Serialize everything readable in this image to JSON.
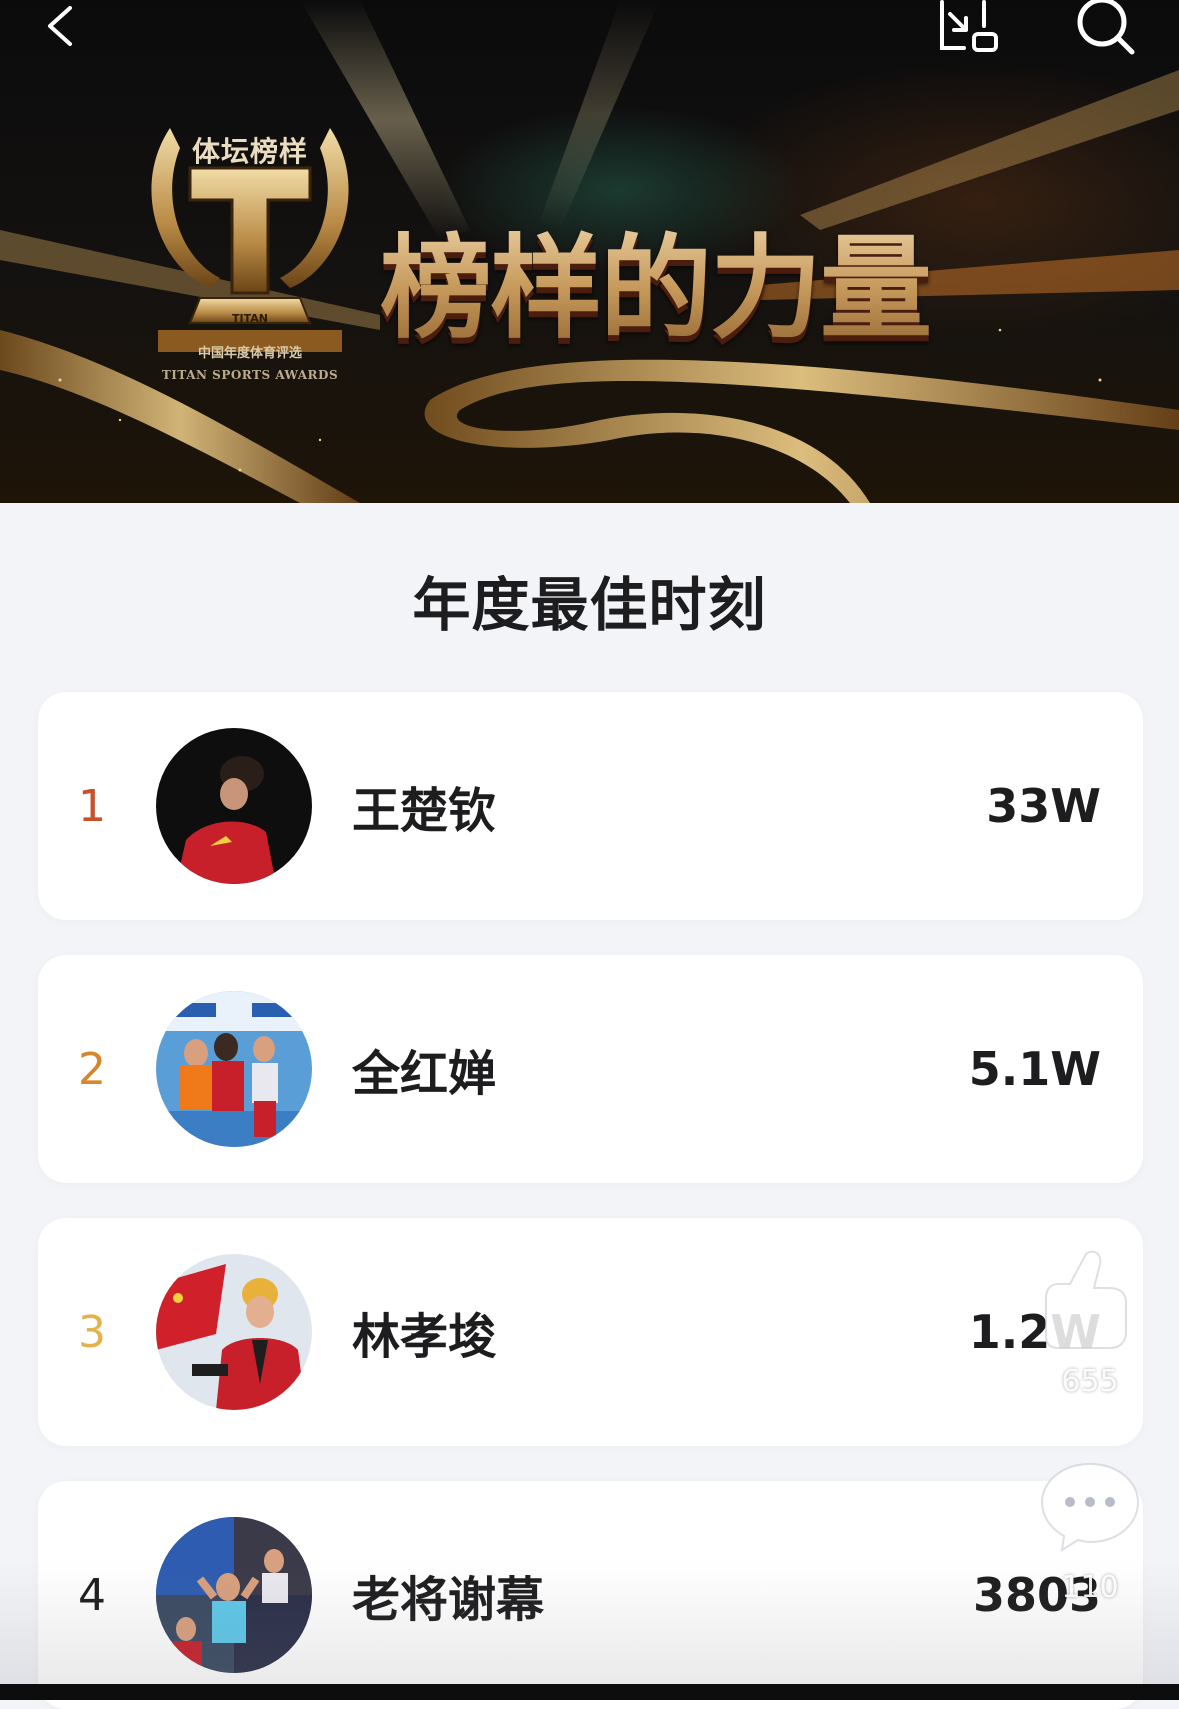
{
  "banner": {
    "logo_top": "体坛榜样",
    "logo_badge": "TITAN",
    "logo_sub": "中国年度体育评选",
    "logo_en": "TITAN SPORTS AWARDS",
    "slogan": "榜样的力量"
  },
  "section_title": "年度最佳时刻",
  "rankings": [
    {
      "rank": "1",
      "name": "王楚钦",
      "value": "33W",
      "rank_color": "#c8502a"
    },
    {
      "rank": "2",
      "name": "全红婵",
      "value": "5.1W",
      "rank_color": "#d9862a"
    },
    {
      "rank": "3",
      "name": "林孝埈",
      "value": "1.2W",
      "rank_color": "#e4b24a"
    },
    {
      "rank": "4",
      "name": "老将谢幕",
      "value": "3803",
      "rank_color": "#1d1d1f"
    }
  ],
  "actions": {
    "like_count": "655",
    "comment_count": "110"
  },
  "icons": [
    "back-icon",
    "share-icon",
    "search-icon",
    "like-icon",
    "comment-icon"
  ]
}
